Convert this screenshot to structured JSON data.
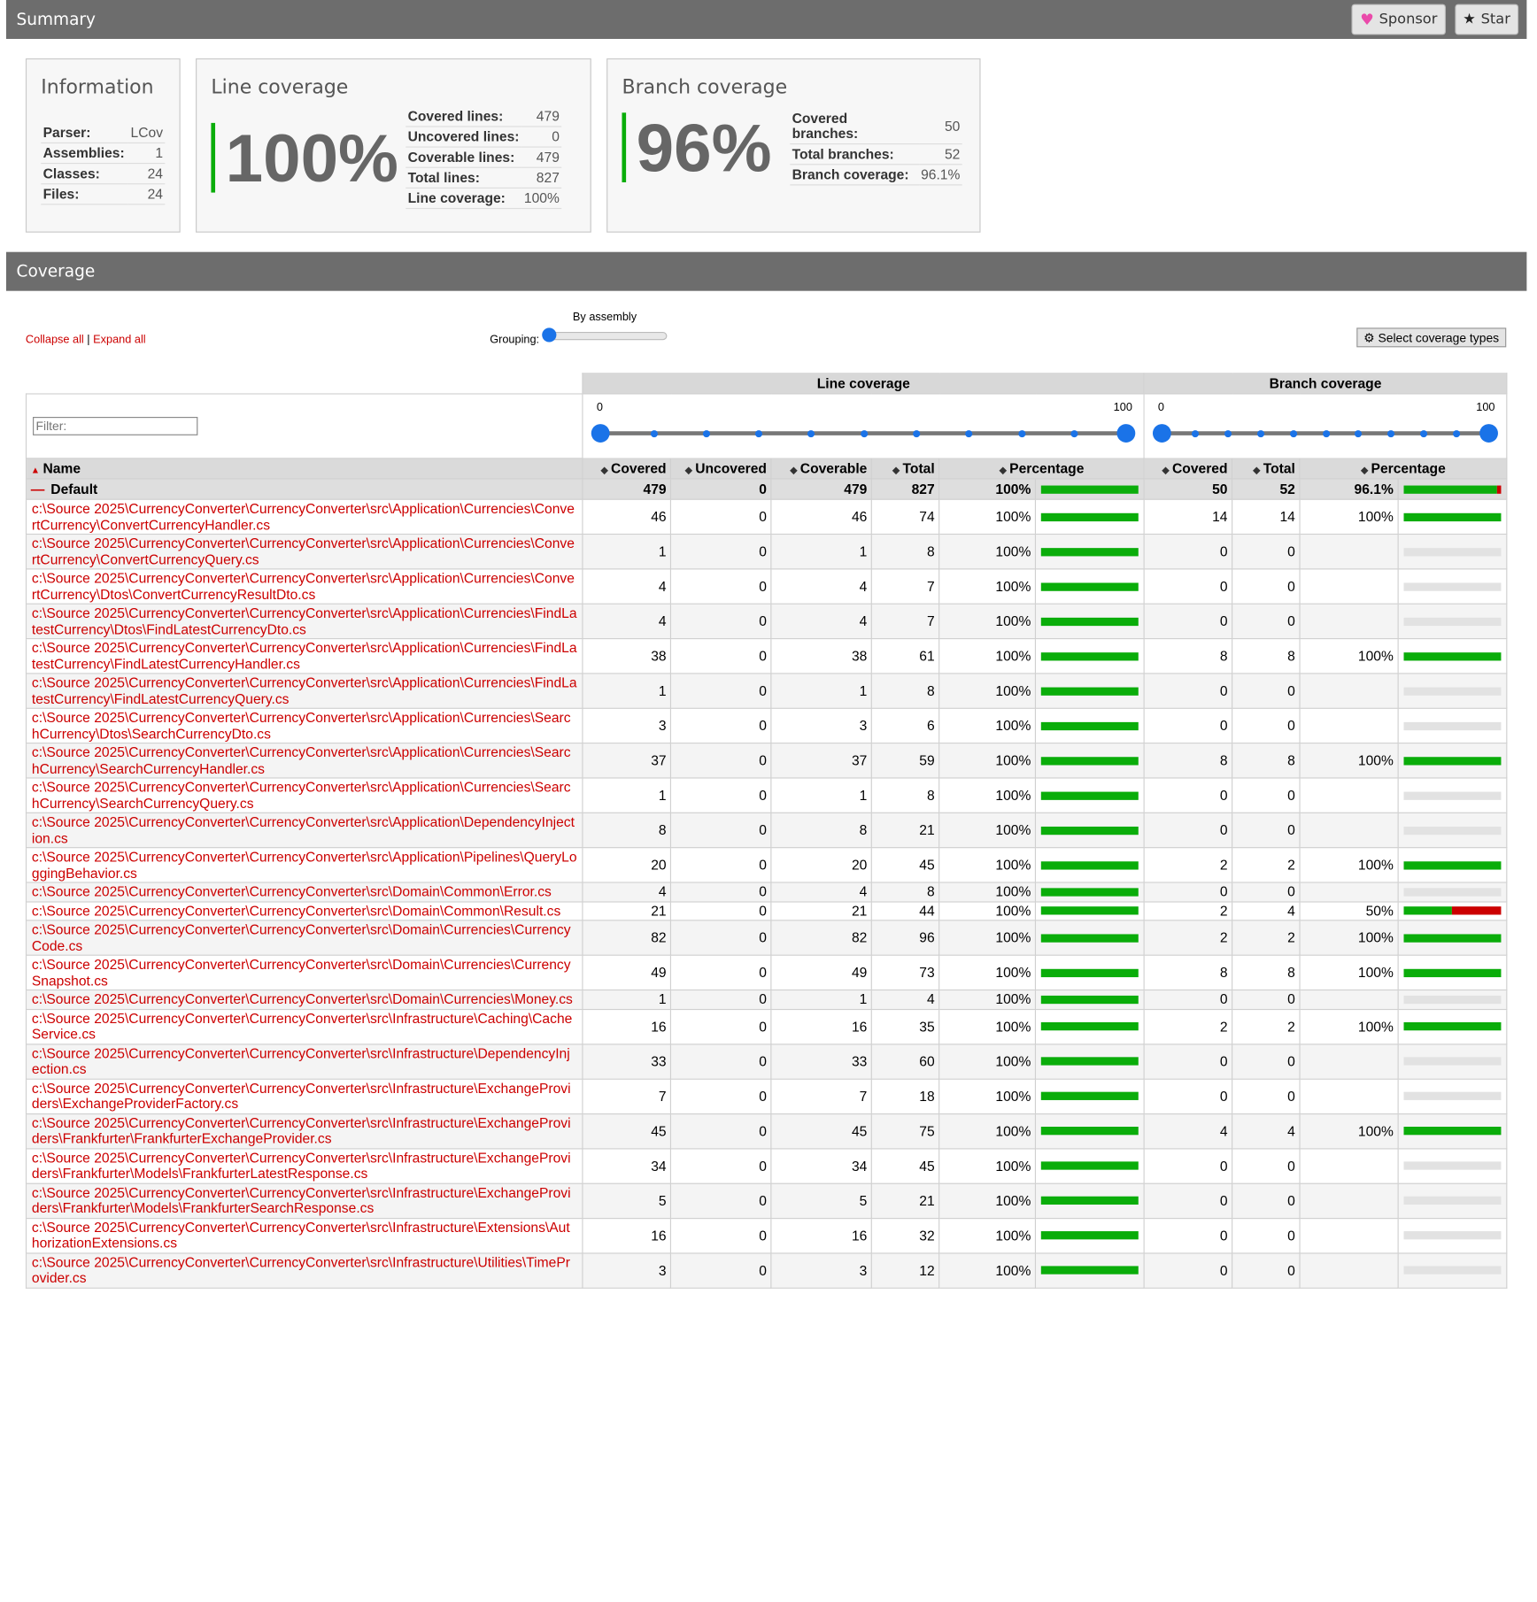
{
  "summary": {
    "title": "Summary",
    "sponsor_label": "Sponsor",
    "star_label": "Star",
    "info": {
      "title": "Information",
      "rows": [
        {
          "label": "Parser:",
          "value": "LCov"
        },
        {
          "label": "Assemblies:",
          "value": "1"
        },
        {
          "label": "Classes:",
          "value": "24"
        },
        {
          "label": "Files:",
          "value": "24"
        }
      ]
    },
    "line": {
      "title": "Line coverage",
      "big": "100%",
      "rows": [
        {
          "label": "Covered lines:",
          "value": "479"
        },
        {
          "label": "Uncovered lines:",
          "value": "0"
        },
        {
          "label": "Coverable lines:",
          "value": "479"
        },
        {
          "label": "Total lines:",
          "value": "827"
        },
        {
          "label": "Line coverage:",
          "value": "100%"
        }
      ]
    },
    "branch": {
      "title": "Branch coverage",
      "big": "96%",
      "rows": [
        {
          "label": "Covered branches:",
          "value": "50"
        },
        {
          "label": "Total branches:",
          "value": "52"
        },
        {
          "label": "Branch coverage:",
          "value": "96.1%"
        }
      ]
    }
  },
  "coverage": {
    "title": "Coverage",
    "collapse_all": "Collapse all",
    "separator": "|",
    "expand_all": "Expand all",
    "grouping_label": "Grouping:",
    "grouping_value": "By assembly",
    "select_types": "Select coverage types",
    "filter_placeholder": "Filter:",
    "line_group": "Line coverage",
    "branch_group": "Branch coverage",
    "slider_min": "0",
    "slider_max": "100",
    "columns": {
      "name": "Name",
      "covered": "Covered",
      "uncovered": "Uncovered",
      "coverable": "Coverable",
      "total": "Total",
      "percentage": "Percentage",
      "b_covered": "Covered",
      "b_total": "Total",
      "b_percentage": "Percentage"
    },
    "group_row": {
      "name": "Default",
      "covered": "479",
      "uncovered": "0",
      "coverable": "479",
      "total": "827",
      "percentage": "100%",
      "line_fill": 1.0,
      "b_covered": "50",
      "b_total": "52",
      "b_percentage": "96.1%",
      "branch_fill": 0.961
    },
    "rows": [
      {
        "name": "c:\\Source 2025\\CurrencyConverter\\CurrencyConverter\\src\\Application\\Currencies\\ConvertCurrency\\ConvertCurrencyHandler.cs",
        "covered": "46",
        "uncovered": "0",
        "coverable": "46",
        "total": "74",
        "pct": "100%",
        "bcov": "14",
        "btotal": "14",
        "bpct": "100%",
        "bfill": 1.0
      },
      {
        "name": "c:\\Source 2025\\CurrencyConverter\\CurrencyConverter\\src\\Application\\Currencies\\ConvertCurrency\\ConvertCurrencyQuery.cs",
        "covered": "1",
        "uncovered": "0",
        "coverable": "1",
        "total": "8",
        "pct": "100%",
        "bcov": "0",
        "btotal": "0",
        "bpct": "",
        "bfill": null
      },
      {
        "name": "c:\\Source 2025\\CurrencyConverter\\CurrencyConverter\\src\\Application\\Currencies\\ConvertCurrency\\Dtos\\ConvertCurrencyResultDto.cs",
        "covered": "4",
        "uncovered": "0",
        "coverable": "4",
        "total": "7",
        "pct": "100%",
        "bcov": "0",
        "btotal": "0",
        "bpct": "",
        "bfill": null
      },
      {
        "name": "c:\\Source 2025\\CurrencyConverter\\CurrencyConverter\\src\\Application\\Currencies\\FindLatestCurrency\\Dtos\\FindLatestCurrencyDto.cs",
        "covered": "4",
        "uncovered": "0",
        "coverable": "4",
        "total": "7",
        "pct": "100%",
        "bcov": "0",
        "btotal": "0",
        "bpct": "",
        "bfill": null
      },
      {
        "name": "c:\\Source 2025\\CurrencyConverter\\CurrencyConverter\\src\\Application\\Currencies\\FindLatestCurrency\\FindLatestCurrencyHandler.cs",
        "covered": "38",
        "uncovered": "0",
        "coverable": "38",
        "total": "61",
        "pct": "100%",
        "bcov": "8",
        "btotal": "8",
        "bpct": "100%",
        "bfill": 1.0
      },
      {
        "name": "c:\\Source 2025\\CurrencyConverter\\CurrencyConverter\\src\\Application\\Currencies\\FindLatestCurrency\\FindLatestCurrencyQuery.cs",
        "covered": "1",
        "uncovered": "0",
        "coverable": "1",
        "total": "8",
        "pct": "100%",
        "bcov": "0",
        "btotal": "0",
        "bpct": "",
        "bfill": null
      },
      {
        "name": "c:\\Source 2025\\CurrencyConverter\\CurrencyConverter\\src\\Application\\Currencies\\SearchCurrency\\Dtos\\SearchCurrencyDto.cs",
        "covered": "3",
        "uncovered": "0",
        "coverable": "3",
        "total": "6",
        "pct": "100%",
        "bcov": "0",
        "btotal": "0",
        "bpct": "",
        "bfill": null
      },
      {
        "name": "c:\\Source 2025\\CurrencyConverter\\CurrencyConverter\\src\\Application\\Currencies\\SearchCurrency\\SearchCurrencyHandler.cs",
        "covered": "37",
        "uncovered": "0",
        "coverable": "37",
        "total": "59",
        "pct": "100%",
        "bcov": "8",
        "btotal": "8",
        "bpct": "100%",
        "bfill": 1.0
      },
      {
        "name": "c:\\Source 2025\\CurrencyConverter\\CurrencyConverter\\src\\Application\\Currencies\\SearchCurrency\\SearchCurrencyQuery.cs",
        "covered": "1",
        "uncovered": "0",
        "coverable": "1",
        "total": "8",
        "pct": "100%",
        "bcov": "0",
        "btotal": "0",
        "bpct": "",
        "bfill": null
      },
      {
        "name": "c:\\Source 2025\\CurrencyConverter\\CurrencyConverter\\src\\Application\\DependencyInjection.cs",
        "covered": "8",
        "uncovered": "0",
        "coverable": "8",
        "total": "21",
        "pct": "100%",
        "bcov": "0",
        "btotal": "0",
        "bpct": "",
        "bfill": null
      },
      {
        "name": "c:\\Source 2025\\CurrencyConverter\\CurrencyConverter\\src\\Application\\Pipelines\\QueryLoggingBehavior.cs",
        "covered": "20",
        "uncovered": "0",
        "coverable": "20",
        "total": "45",
        "pct": "100%",
        "bcov": "2",
        "btotal": "2",
        "bpct": "100%",
        "bfill": 1.0
      },
      {
        "name": "c:\\Source 2025\\CurrencyConverter\\CurrencyConverter\\src\\Domain\\Common\\Error.cs",
        "covered": "4",
        "uncovered": "0",
        "coverable": "4",
        "total": "8",
        "pct": "100%",
        "bcov": "0",
        "btotal": "0",
        "bpct": "",
        "bfill": null
      },
      {
        "name": "c:\\Source 2025\\CurrencyConverter\\CurrencyConverter\\src\\Domain\\Common\\Result.cs",
        "covered": "21",
        "uncovered": "0",
        "coverable": "21",
        "total": "44",
        "pct": "100%",
        "bcov": "2",
        "btotal": "4",
        "bpct": "50%",
        "bfill": 0.5
      },
      {
        "name": "c:\\Source 2025\\CurrencyConverter\\CurrencyConverter\\src\\Domain\\Currencies\\CurrencyCode.cs",
        "covered": "82",
        "uncovered": "0",
        "coverable": "82",
        "total": "96",
        "pct": "100%",
        "bcov": "2",
        "btotal": "2",
        "bpct": "100%",
        "bfill": 1.0
      },
      {
        "name": "c:\\Source 2025\\CurrencyConverter\\CurrencyConverter\\src\\Domain\\Currencies\\CurrencySnapshot.cs",
        "covered": "49",
        "uncovered": "0",
        "coverable": "49",
        "total": "73",
        "pct": "100%",
        "bcov": "8",
        "btotal": "8",
        "bpct": "100%",
        "bfill": 1.0
      },
      {
        "name": "c:\\Source 2025\\CurrencyConverter\\CurrencyConverter\\src\\Domain\\Currencies\\Money.cs",
        "covered": "1",
        "uncovered": "0",
        "coverable": "1",
        "total": "4",
        "pct": "100%",
        "bcov": "0",
        "btotal": "0",
        "bpct": "",
        "bfill": null
      },
      {
        "name": "c:\\Source 2025\\CurrencyConverter\\CurrencyConverter\\src\\Infrastructure\\Caching\\CacheService.cs",
        "covered": "16",
        "uncovered": "0",
        "coverable": "16",
        "total": "35",
        "pct": "100%",
        "bcov": "2",
        "btotal": "2",
        "bpct": "100%",
        "bfill": 1.0
      },
      {
        "name": "c:\\Source 2025\\CurrencyConverter\\CurrencyConverter\\src\\Infrastructure\\DependencyInjection.cs",
        "covered": "33",
        "uncovered": "0",
        "coverable": "33",
        "total": "60",
        "pct": "100%",
        "bcov": "0",
        "btotal": "0",
        "bpct": "",
        "bfill": null
      },
      {
        "name": "c:\\Source 2025\\CurrencyConverter\\CurrencyConverter\\src\\Infrastructure\\ExchangeProviders\\ExchangeProviderFactory.cs",
        "covered": "7",
        "uncovered": "0",
        "coverable": "7",
        "total": "18",
        "pct": "100%",
        "bcov": "0",
        "btotal": "0",
        "bpct": "",
        "bfill": null
      },
      {
        "name": "c:\\Source 2025\\CurrencyConverter\\CurrencyConverter\\src\\Infrastructure\\ExchangeProviders\\Frankfurter\\FrankfurterExchangeProvider.cs",
        "covered": "45",
        "uncovered": "0",
        "coverable": "45",
        "total": "75",
        "pct": "100%",
        "bcov": "4",
        "btotal": "4",
        "bpct": "100%",
        "bfill": 1.0
      },
      {
        "name": "c:\\Source 2025\\CurrencyConverter\\CurrencyConverter\\src\\Infrastructure\\ExchangeProviders\\Frankfurter\\Models\\FrankfurterLatestResponse.cs",
        "covered": "34",
        "uncovered": "0",
        "coverable": "34",
        "total": "45",
        "pct": "100%",
        "bcov": "0",
        "btotal": "0",
        "bpct": "",
        "bfill": null
      },
      {
        "name": "c:\\Source 2025\\CurrencyConverter\\CurrencyConverter\\src\\Infrastructure\\ExchangeProviders\\Frankfurter\\Models\\FrankfurterSearchResponse.cs",
        "covered": "5",
        "uncovered": "0",
        "coverable": "5",
        "total": "21",
        "pct": "100%",
        "bcov": "0",
        "btotal": "0",
        "bpct": "",
        "bfill": null
      },
      {
        "name": "c:\\Source 2025\\CurrencyConverter\\CurrencyConverter\\src\\Infrastructure\\Extensions\\AuthorizationExtensions.cs",
        "covered": "16",
        "uncovered": "0",
        "coverable": "16",
        "total": "32",
        "pct": "100%",
        "bcov": "0",
        "btotal": "0",
        "bpct": "",
        "bfill": null
      },
      {
        "name": "c:\\Source 2025\\CurrencyConverter\\CurrencyConverter\\src\\Infrastructure\\Utilities\\TimeProvider.cs",
        "covered": "3",
        "uncovered": "0",
        "coverable": "3",
        "total": "12",
        "pct": "100%",
        "bcov": "0",
        "btotal": "0",
        "bpct": "",
        "bfill": null
      }
    ]
  },
  "colors": {
    "header_bg": "#6d6d6d",
    "covered_green": "#0aad0a",
    "uncovered_red": "#c00000",
    "link_red": "#cc0000",
    "slider_blue": "#1a73e8"
  },
  "icons": {
    "sponsor": "heart-icon",
    "star": "star-icon",
    "settings": "gear-icon",
    "sort": "sort-icon",
    "collapse": "minus-icon"
  }
}
